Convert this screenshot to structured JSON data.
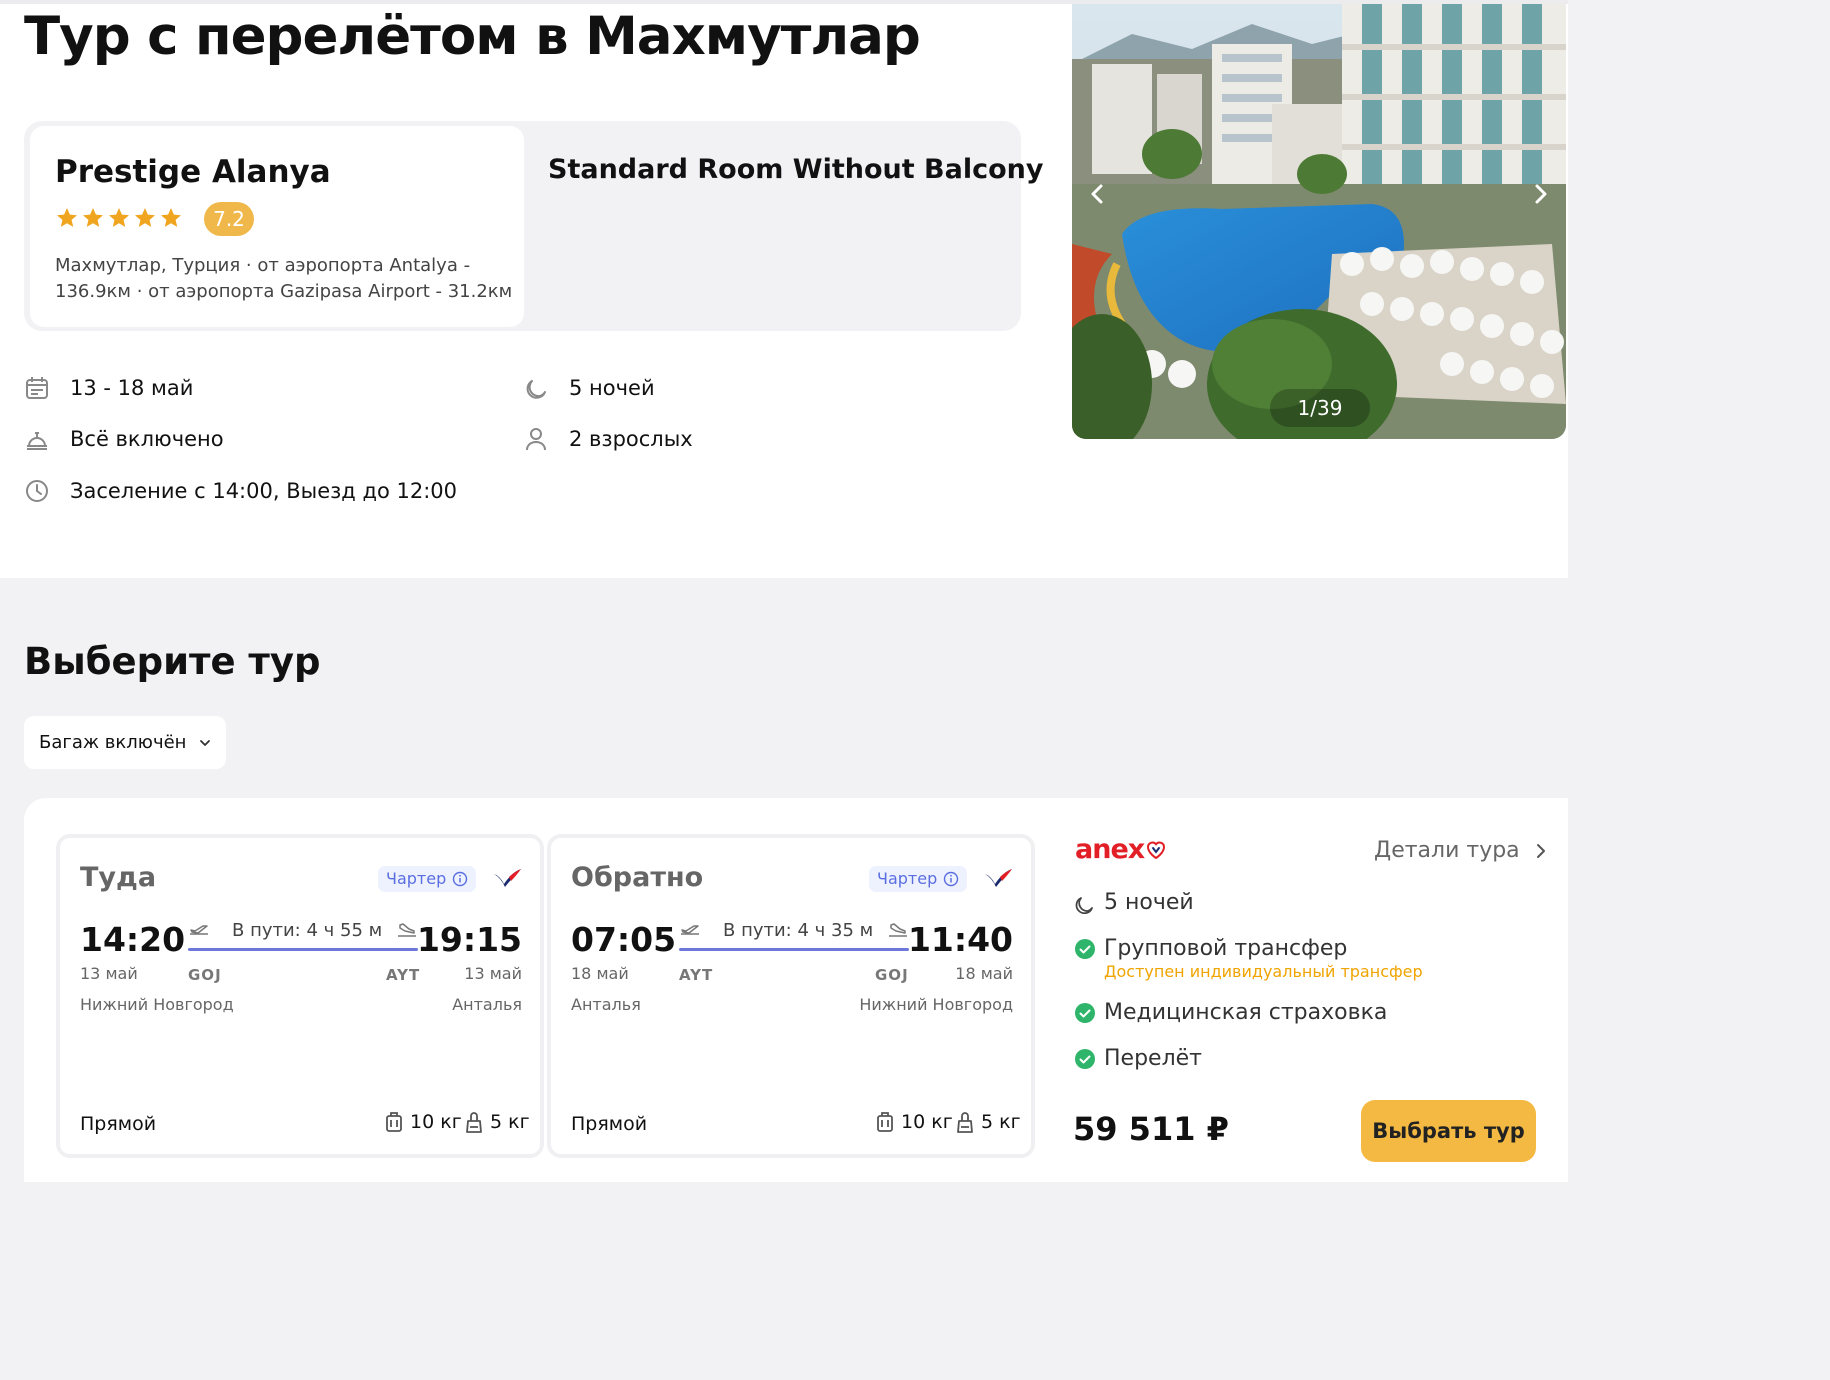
{
  "page": {
    "title": "Тур с перелётом в Махмутлар"
  },
  "hotel": {
    "name": "Prestige Alanya",
    "stars": 5,
    "rating": "7.2",
    "location": "Махмутлар, Турция · от аэропорта Antalya - 136.9км · от аэропорта Gazipasa Airport - 31.2км",
    "room": "Standard Room Without Balcony"
  },
  "info": {
    "dates": "13 - 18 май",
    "nights": "5 ночей",
    "meal": "Всё включено",
    "guests": "2 взрослых",
    "checkin": "Заселение с 14:00, Выезд до 12:00"
  },
  "gallery": {
    "counter": "1/39"
  },
  "select": {
    "title": "Выберите тур",
    "filter_label": "Багаж включён"
  },
  "tour": {
    "outbound": {
      "title": "Туда",
      "charter": "Чартер",
      "dep_time": "14:20",
      "dep_date": "13 май",
      "dep_city": "Нижний Новгород",
      "dep_code": "GOJ",
      "duration": "В пути: 4 ч 55 м",
      "arr_code": "AYT",
      "arr_time": "19:15",
      "arr_date": "13 май",
      "arr_city": "Анталья",
      "type": "Прямой",
      "baggage": "10 кг",
      "hand": "5 кг"
    },
    "return": {
      "title": "Обратно",
      "charter": "Чартер",
      "dep_time": "07:05",
      "dep_date": "18 май",
      "dep_city": "Анталья",
      "dep_code": "AYT",
      "duration": "В пути: 4 ч 35 м",
      "arr_code": "GOJ",
      "arr_time": "11:40",
      "arr_date": "18 май",
      "arr_city": "Нижний Новгород",
      "type": "Прямой",
      "baggage": "10 кг",
      "hand": "5 кг"
    },
    "operator": "anex",
    "details_label": "Детали тура",
    "nights": "5 ночей",
    "features": [
      "Групповой трансфер",
      "Медицинская страховка",
      "Перелёт"
    ],
    "transfer_note": "Доступен индивидуальный трансфер",
    "price": "59 511 ₽",
    "select_label": "Выбрать тур"
  },
  "colors": {
    "accent": "#f4b942",
    "rating": "#f0b84a",
    "route": "#6b77d9",
    "operator": "#e21f26",
    "check": "#2fb56b",
    "note": "#f0a400"
  }
}
